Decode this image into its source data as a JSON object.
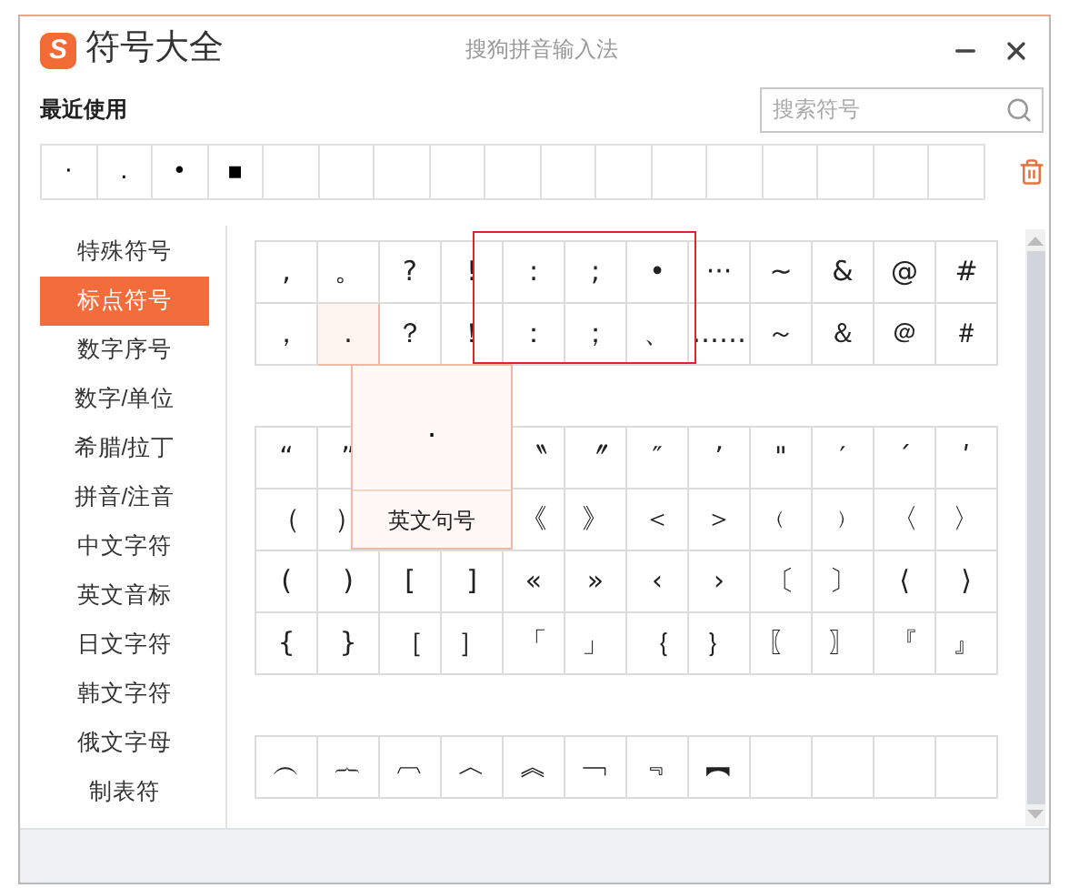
{
  "window": {
    "logo_letter": "S",
    "title": "符号大全",
    "app_name": "搜狗拼音输入法"
  },
  "recent": {
    "label": "最近使用",
    "symbols": [
      "·",
      ".",
      "•",
      "▪"
    ]
  },
  "search": {
    "placeholder": "搜索符号"
  },
  "sidebar": {
    "items": [
      {
        "label": "特殊符号",
        "selected": false
      },
      {
        "label": "标点符号",
        "selected": true
      },
      {
        "label": "数字序号",
        "selected": false
      },
      {
        "label": "数字/单位",
        "selected": false
      },
      {
        "label": "希腊/拉丁",
        "selected": false
      },
      {
        "label": "拼音/注音",
        "selected": false
      },
      {
        "label": "中文字符",
        "selected": false
      },
      {
        "label": "英文音标",
        "selected": false
      },
      {
        "label": "日文字符",
        "selected": false
      },
      {
        "label": "韩文字符",
        "selected": false
      },
      {
        "label": "俄文字母",
        "selected": false
      },
      {
        "label": "制表符",
        "selected": false
      }
    ]
  },
  "groups": [
    {
      "rows": [
        [
          {
            "s": ",",
            "selected": false
          },
          {
            "s": "。",
            "selected": false
          },
          {
            "s": "?",
            "selected": false
          },
          {
            "s": "!",
            "selected": false
          },
          {
            "s": ":",
            "selected": false
          },
          {
            "s": ";",
            "selected": false
          },
          {
            "s": "•",
            "selected": false
          },
          {
            "s": "···",
            "selected": false
          },
          {
            "s": "~",
            "selected": false
          },
          {
            "s": "&",
            "selected": false
          },
          {
            "s": "@",
            "selected": false
          },
          {
            "s": "#",
            "selected": false
          }
        ],
        [
          {
            "s": "，",
            "selected": false
          },
          {
            "s": ".",
            "selected": true
          },
          {
            "s": "？",
            "selected": false
          },
          {
            "s": "！",
            "selected": false
          },
          {
            "s": "：",
            "selected": false
          },
          {
            "s": "；",
            "selected": false
          },
          {
            "s": "、",
            "selected": false
          },
          {
            "s": "……",
            "selected": false
          },
          {
            "s": "～",
            "selected": false
          },
          {
            "s": "＆",
            "selected": false
          },
          {
            "s": "＠",
            "selected": false
          },
          {
            "s": "＃",
            "selected": false
          }
        ]
      ]
    },
    {
      "rows": [
        [
          {
            "s": "“",
            "selected": false
          },
          {
            "s": "”",
            "selected": false
          },
          null,
          null,
          {
            "s": "〝",
            "selected": false
          },
          {
            "s": "〞",
            "selected": false
          },
          {
            "s": "″",
            "selected": false
          },
          {
            "s": "’",
            "selected": false
          },
          {
            "s": "\"",
            "selected": false
          },
          {
            "s": "′",
            "selected": false
          },
          {
            "s": "ˊ",
            "selected": false
          },
          {
            "s": "ʹ",
            "selected": false
          }
        ],
        [
          {
            "s": "（",
            "selected": false
          },
          {
            "s": "）",
            "selected": false
          },
          null,
          null,
          {
            "s": "《",
            "selected": false
          },
          {
            "s": "》",
            "selected": false
          },
          {
            "s": "＜",
            "selected": false
          },
          {
            "s": "＞",
            "selected": false
          },
          {
            "s": "﹙",
            "selected": false
          },
          {
            "s": "﹚",
            "selected": false
          },
          {
            "s": "〈",
            "selected": false
          },
          {
            "s": "〉",
            "selected": false
          }
        ],
        [
          {
            "s": "(",
            "selected": false
          },
          {
            "s": ")",
            "selected": false
          },
          {
            "s": "[",
            "selected": false
          },
          {
            "s": "]",
            "selected": false
          },
          {
            "s": "«",
            "selected": false
          },
          {
            "s": "»",
            "selected": false
          },
          {
            "s": "‹",
            "selected": false
          },
          {
            "s": "›",
            "selected": false
          },
          {
            "s": "〔",
            "selected": false
          },
          {
            "s": "〕",
            "selected": false
          },
          {
            "s": "⟨",
            "selected": false
          },
          {
            "s": "⟩",
            "selected": false
          }
        ],
        [
          {
            "s": "{",
            "selected": false
          },
          {
            "s": "}",
            "selected": false
          },
          {
            "s": "［",
            "selected": false
          },
          {
            "s": "］",
            "selected": false
          },
          {
            "s": "「",
            "selected": false
          },
          {
            "s": "」",
            "selected": false
          },
          {
            "s": "｛",
            "selected": false
          },
          {
            "s": "｝",
            "selected": false
          },
          {
            "s": "〖",
            "selected": false
          },
          {
            "s": "〗",
            "selected": false
          },
          {
            "s": "『",
            "selected": false
          },
          {
            "s": "』",
            "selected": false
          }
        ]
      ]
    },
    {
      "rows": [
        [
          {
            "s": "︵",
            "selected": false
          },
          {
            "s": "︷",
            "selected": false
          },
          {
            "s": "︹",
            "selected": false
          },
          {
            "s": "︿",
            "selected": false
          },
          {
            "s": "︽",
            "selected": false
          },
          {
            "s": "﹁",
            "selected": false
          },
          {
            "s": "﹃",
            "selected": false
          },
          {
            "s": "︻",
            "selected": false
          },
          null,
          null,
          null,
          null
        ]
      ]
    }
  ],
  "tooltip": {
    "symbol": ".",
    "label": "英文句号"
  }
}
